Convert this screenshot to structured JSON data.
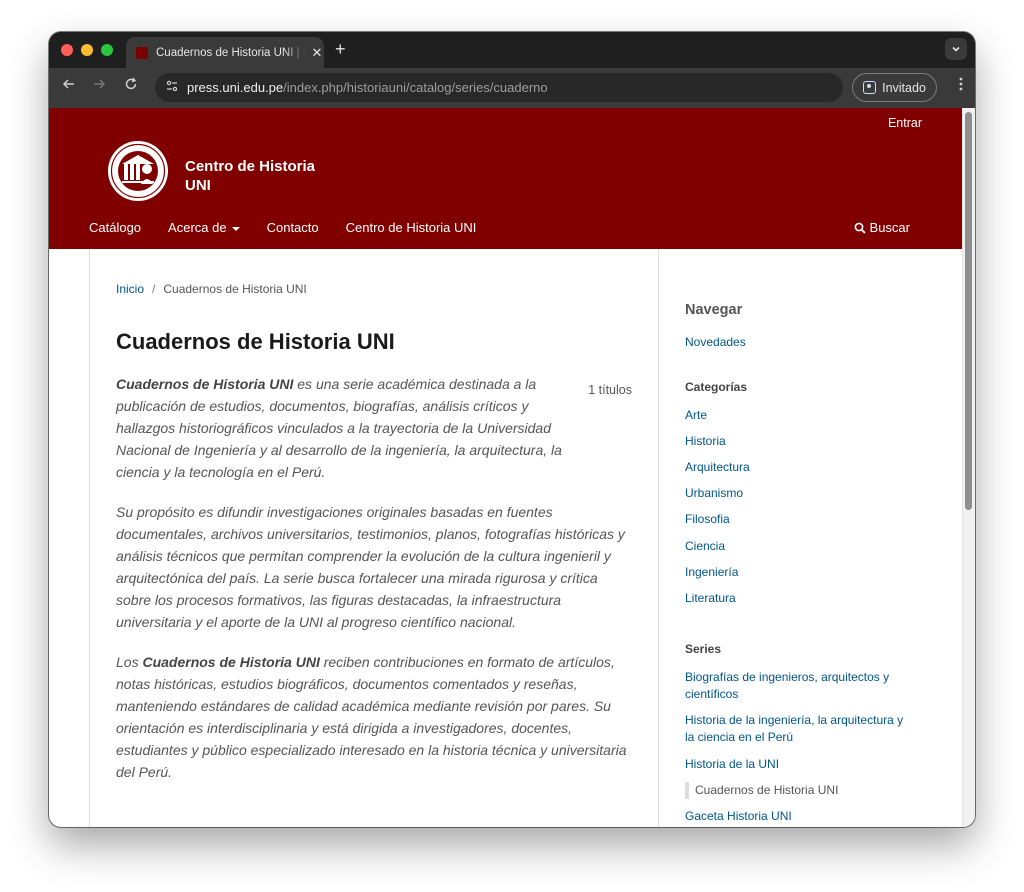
{
  "browser": {
    "tab_title": "Cuadernos de Historia UNI | C",
    "tab_close": "✕",
    "new_tab": "+",
    "url_host": "press.uni.edu.pe",
    "url_path": "/index.php/historiauni/catalog/series/cuaderno",
    "profile_label": "Invitado"
  },
  "header": {
    "login": "Entrar",
    "site_name": "Centro de Historia UNI",
    "nav": [
      {
        "label": "Catálogo"
      },
      {
        "label": "Acerca de"
      },
      {
        "label": "Contacto"
      },
      {
        "label": "Centro de Historia UNI"
      }
    ],
    "search": "Buscar"
  },
  "main": {
    "breadcrumb": {
      "home": "Inicio",
      "sep": "/",
      "current": "Cuadernos de Historia UNI"
    },
    "title": "Cuadernos de Historia UNI",
    "count": "1 títulos",
    "p1_bold": "Cuadernos de Historia UNI",
    "p1_rest": " es una serie académica destinada a la publicación de estudios, documentos, biografías, análisis críticos y hallazgos historiográficos vinculados a la trayectoria de la Universidad Nacional de Ingeniería y al desarrollo de la ingeniería, la arquitectura, la ciencia y la tecnología en el Perú.",
    "p2": "Su propósito es difundir investigaciones originales basadas en fuentes documentales, archivos universitarios, testimonios, planos, fotografías históricas y análisis técnicos que permitan comprender la evolución de la cultura ingenieril y arquitectónica del país. La serie busca fortalecer una mirada rigurosa y crítica sobre los procesos formativos, las figuras destacadas, la infraestructura universitaria y el aporte de la UNI al progreso científico nacional.",
    "p3_pre": "Los ",
    "p3_bold": "Cuadernos de Historia UNI",
    "p3_rest": " reciben contribuciones en formato de artículos, notas históricas, estudios biográficos, documentos comentados y reseñas, manteniendo estándares de calidad académica mediante revisión por pares. Su orientación es interdisciplinaria y está dirigida a investigadores, docentes, estudiantes y público especializado interesado en la historia técnica y universitaria del Perú."
  },
  "sidebar": {
    "browse_heading": "Navegar",
    "novedades": "Novedades",
    "categories_heading": "Categorías",
    "categories": [
      "Arte",
      "Historia",
      "Arquitectura",
      "Urbanismo",
      "Filosofia",
      "Ciencia",
      "Ingeniería",
      "Literatura"
    ],
    "series_heading": "Series",
    "series": [
      "Biografías de ingenieros, arquitectos y científicos",
      "Historia de la ingeniería, la arquitectura y la ciencia en el Perú",
      "Historia de la UNI"
    ],
    "series_current": "Cuadernos de Historia UNI",
    "series_last": "Gaceta Historia UNI"
  },
  "colors": {
    "header_bg": "#800000",
    "link": "#00558b"
  }
}
